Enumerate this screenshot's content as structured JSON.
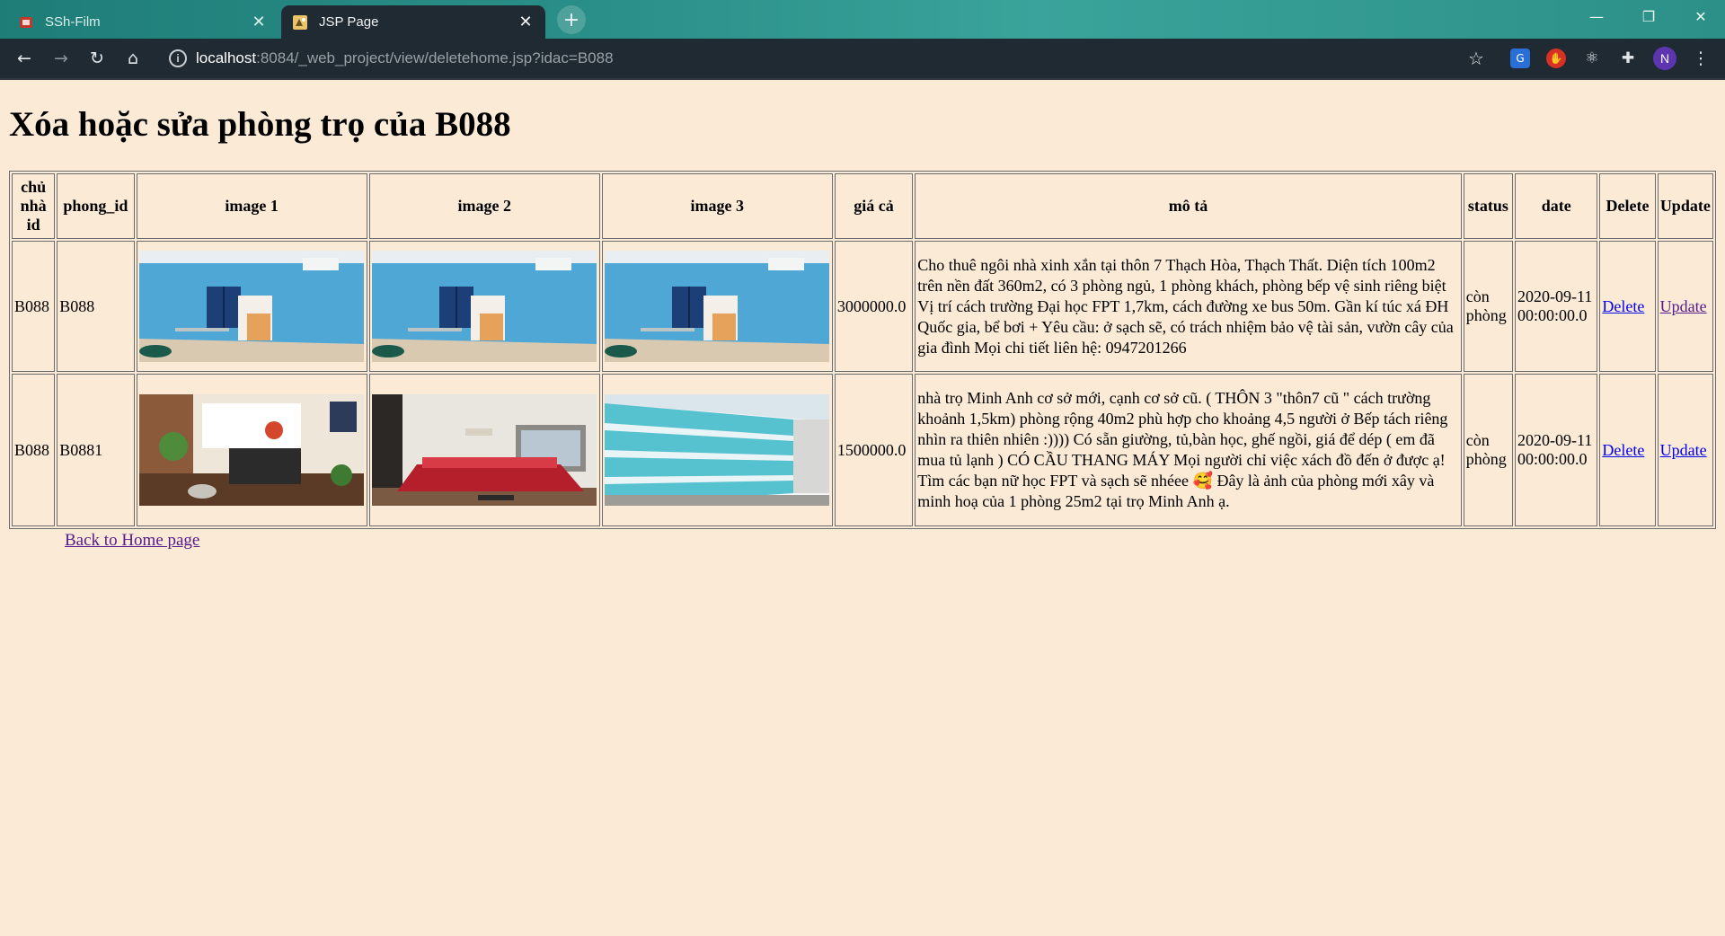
{
  "browser": {
    "tabs": [
      {
        "label": "SSh-Film",
        "active": false
      },
      {
        "label": "JSP Page",
        "active": true
      }
    ],
    "url_host": "localhost",
    "url_path": ":8084/_web_project/view/deletehome.jsp?idac=B088",
    "profile_initial": "N"
  },
  "page": {
    "title": "Xóa hoặc sửa phòng trọ của B088",
    "headers": {
      "owner": "chủ nhà id",
      "room": "phong_id",
      "img1": "image 1",
      "img2": "image 2",
      "img3": "image 3",
      "price": "giá cả",
      "desc": "mô tả",
      "status": "status",
      "date": "date",
      "delete": "Delete",
      "update": "Update"
    },
    "rows": [
      {
        "owner": "B088",
        "room": "B088",
        "price": "3000000.0",
        "desc": "Cho thuê ngôi nhà xinh xắn tại thôn 7 Thạch Hòa, Thạch Thất. Diện tích 100m2 trên nền đất 360m2, có 3 phòng ngủ, 1 phòng khách, phòng bếp vệ sinh riêng biệt Vị trí cách trường Đại học FPT 1,7km, cách đường xe bus 50m. Gần kí túc xá ĐH Quốc gia, bể bơi + Yêu cầu: ở sạch sẽ, có trách nhiệm bảo vệ tài sản, vườn cây của gia đình Mọi chi tiết liên hệ: 0947201266",
        "status": "còn phòng",
        "date": "2020-09-11 00:00:00.0",
        "delete_label": "Delete",
        "update_label": "Update"
      },
      {
        "owner": "B088",
        "room": "B0881",
        "price": "1500000.0",
        "desc": "nhà trọ Minh Anh cơ sở mới, cạnh cơ sở cũ. ( THÔN 3 \"thôn7 cũ \" cách trường khoảnh 1,5km) phòng rộng 40m2 phù hợp cho khoảng 4,5 người ở Bếp tách riêng nhìn ra thiên nhiên :)))) Có sẵn giường, tủ,bàn học, ghế ngồi, giá để dép ( em đã mua tủ lạnh ) CÓ CẦU THANG MÁY Mọi người chỉ việc xách đồ đến ở được ạ! Tìm các bạn nữ học FPT và sạch sẽ nhéee 🥰 Đây là ảnh của phòng mới xây và minh hoạ của 1 phòng 25m2 tại trọ Minh Anh ạ.",
        "status": "còn phòng",
        "date": "2020-09-11 00:00:00.0",
        "delete_label": "Delete",
        "update_label": "Update"
      }
    ],
    "back_link": "Back to Home page"
  }
}
